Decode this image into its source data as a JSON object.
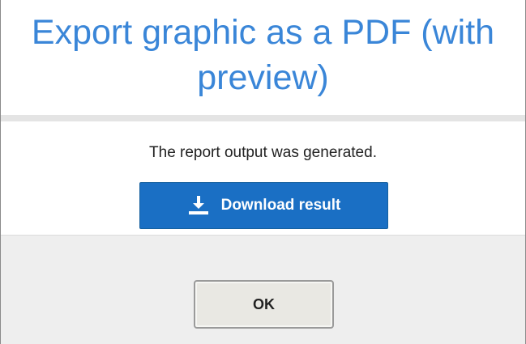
{
  "dialog": {
    "title": "Export graphic as a PDF (with preview)",
    "message": "The report output was generated.",
    "download_button": {
      "label": "Download result",
      "icon": "download-icon"
    },
    "ok_button": {
      "label": "OK"
    }
  },
  "colors": {
    "title": "#3a86d8",
    "primary_button": "#1a6fc4",
    "footer_background": "#eeeeee",
    "divider": "#e4e4e4"
  }
}
